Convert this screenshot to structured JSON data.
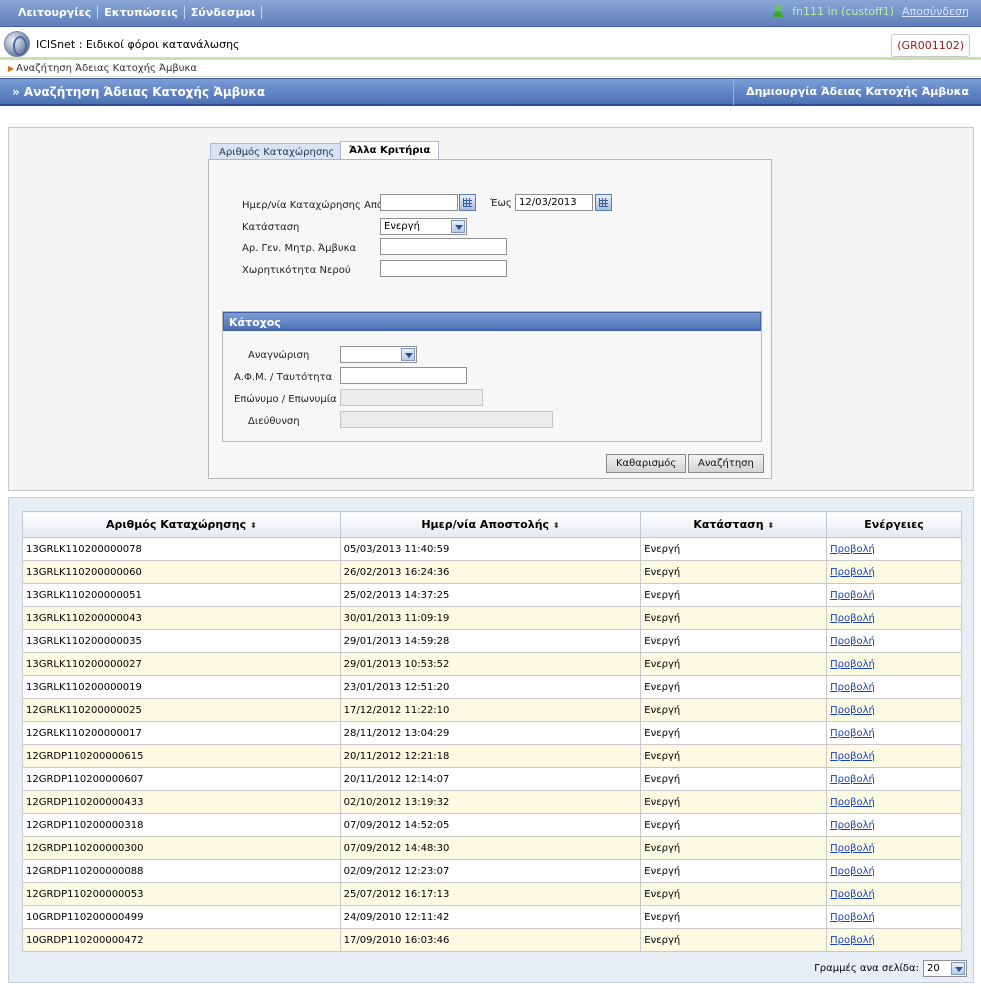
{
  "topbar": {
    "menu": [
      "Λειτουργίες",
      "Εκτυπώσεις",
      "Σύνδεσμοι"
    ],
    "user": "fn111 ln (custoff1)",
    "logout": "Αποσύνδεση"
  },
  "app": {
    "title": "ICISnet : Ειδικοί φόροι κατανάλωσης",
    "office_code": "(GR001102)"
  },
  "breadcrumb": "Αναζήτηση Άδειας Κατοχής Άμβυκα",
  "section": {
    "title": "» Αναζήτηση Άδειας Κατοχής Άμβυκα",
    "create_link": "Δημιουργία Άδειας Κατοχής Άμβυκα"
  },
  "tabs": [
    "Αριθμός Καταχώρησης",
    "Άλλα Κριτήρια"
  ],
  "form": {
    "date_from_label": "Ημερ/νία Καταχώρησης Από",
    "date_from_value": "",
    "date_to_label": "Έως",
    "date_to_value": "12/03/2013",
    "status_label": "Κατάσταση",
    "status_value": "Ενεργή",
    "gen_reg_label": "Αρ. Γεν. Μητρ. Άμβυκα",
    "water_label": "Χωρητικότητα Νερού"
  },
  "owner": {
    "title": "Κάτοχος",
    "ident_label": "Αναγνώριση",
    "afm_label": "Α.Φ.Μ. / Ταυτότητα",
    "name_label": "Επώνυμο / Επωνυμία",
    "address_label": "Διεύθυνση"
  },
  "buttons": {
    "clear": "Καθαρισμός",
    "search": "Αναζήτηση"
  },
  "table": {
    "headers": [
      "Αριθμός Καταχώρησης",
      "Ημερ/νία Αποστολής",
      "Κατάσταση",
      "Ενέργειες"
    ],
    "sort_glyph": "⬍",
    "rows": [
      [
        "13GRLK110200000078",
        "05/03/2013 11:40:59",
        "Ενεργή",
        "Προβολή"
      ],
      [
        "13GRLK110200000060",
        "26/02/2013 16:24:36",
        "Ενεργή",
        "Προβολή"
      ],
      [
        "13GRLK110200000051",
        "25/02/2013 14:37:25",
        "Ενεργή",
        "Προβολή"
      ],
      [
        "13GRLK110200000043",
        "30/01/2013 11:09:19",
        "Ενεργή",
        "Προβολή"
      ],
      [
        "13GRLK110200000035",
        "29/01/2013 14:59:28",
        "Ενεργή",
        "Προβολή"
      ],
      [
        "13GRLK110200000027",
        "29/01/2013 10:53:52",
        "Ενεργή",
        "Προβολή"
      ],
      [
        "13GRLK110200000019",
        "23/01/2013 12:51:20",
        "Ενεργή",
        "Προβολή"
      ],
      [
        "12GRLK110200000025",
        "17/12/2012 11:22:10",
        "Ενεργή",
        "Προβολή"
      ],
      [
        "12GRLK110200000017",
        "28/11/2012 13:04:29",
        "Ενεργή",
        "Προβολή"
      ],
      [
        "12GRDP110200000615",
        "20/11/2012 12:21:18",
        "Ενεργή",
        "Προβολή"
      ],
      [
        "12GRDP110200000607",
        "20/11/2012 12:14:07",
        "Ενεργή",
        "Προβολή"
      ],
      [
        "12GRDP110200000433",
        "02/10/2012 13:19:32",
        "Ενεργή",
        "Προβολή"
      ],
      [
        "12GRDP110200000318",
        "07/09/2012 14:52:05",
        "Ενεργή",
        "Προβολή"
      ],
      [
        "12GRDP110200000300",
        "07/09/2012 14:48:30",
        "Ενεργή",
        "Προβολή"
      ],
      [
        "12GRDP110200000088",
        "02/09/2012 12:23:07",
        "Ενεργή",
        "Προβολή"
      ],
      [
        "12GRDP110200000053",
        "25/07/2012 16:17:13",
        "Ενεργή",
        "Προβολή"
      ],
      [
        "10GRDP110200000499",
        "24/09/2010 12:11:42",
        "Ενεργή",
        "Προβολή"
      ],
      [
        "10GRDP110200000472",
        "17/09/2010 16:03:46",
        "Ενεργή",
        "Προβολή"
      ]
    ]
  },
  "pager": {
    "label": "Γραμμές ανα σελίδα:",
    "value": "20"
  }
}
